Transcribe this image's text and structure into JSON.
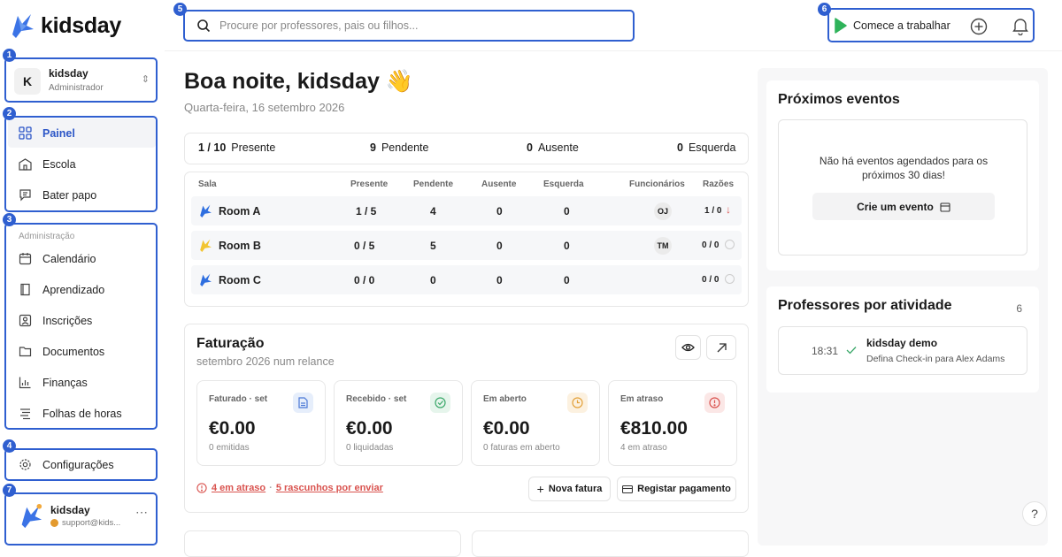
{
  "app": {
    "name": "kidsday"
  },
  "badges": [
    "1",
    "2",
    "3",
    "4",
    "5",
    "6",
    "7"
  ],
  "account": {
    "initial": "K",
    "name": "kidsday",
    "role": "Administrador"
  },
  "nav": {
    "main": [
      {
        "label": "Painel",
        "icon": "grid-icon",
        "active": true
      },
      {
        "label": "Escola",
        "icon": "school-icon"
      },
      {
        "label": "Bater papo",
        "icon": "chat-icon"
      }
    ],
    "admin_title": "Administração",
    "admin": [
      {
        "label": "Calendário",
        "icon": "calendar-icon"
      },
      {
        "label": "Aprendizado",
        "icon": "book-icon"
      },
      {
        "label": "Inscrições",
        "icon": "enroll-icon"
      },
      {
        "label": "Documentos",
        "icon": "folder-icon"
      },
      {
        "label": "Finanças",
        "icon": "finance-icon"
      },
      {
        "label": "Folhas de horas",
        "icon": "timesheet-icon"
      }
    ],
    "settings": "Configurações"
  },
  "user": {
    "name": "kidsday",
    "email": "support@kids..."
  },
  "search": {
    "placeholder": "Procure por professores, pais ou filhos..."
  },
  "top": {
    "work_label": "Comece a trabalhar"
  },
  "greeting": {
    "title": "Boa noite, kidsday 👋",
    "date": "Quarta-feira, 16 setembro 2026"
  },
  "stats": [
    {
      "value": "1 / 10",
      "label": "Presente"
    },
    {
      "value": "9",
      "label": "Pendente"
    },
    {
      "value": "0",
      "label": "Ausente"
    },
    {
      "value": "0",
      "label": "Esquerda"
    }
  ],
  "table": {
    "headers": [
      "Sala",
      "Presente",
      "Pendente",
      "Ausente",
      "Esquerda",
      "Funcionários",
      "Razões"
    ],
    "rows": [
      {
        "name": "Room A",
        "present": "1 / 5",
        "pending": "4",
        "absent": "0",
        "left": "0",
        "staff": "OJ",
        "ratio": "1 / 0",
        "color": "#2f6fe0"
      },
      {
        "name": "Room B",
        "present": "0 / 5",
        "pending": "5",
        "absent": "0",
        "left": "0",
        "staff": "TM",
        "ratio": "0 / 0",
        "color": "#f2c531"
      },
      {
        "name": "Room C",
        "present": "0 / 0",
        "pending": "0",
        "absent": "0",
        "left": "0",
        "staff": "",
        "ratio": "0 / 0",
        "color": "#2f6fe0"
      }
    ]
  },
  "billing": {
    "title": "Faturação",
    "subtitle": "setembro 2026 num relance",
    "cards": [
      {
        "label": "Faturado · set",
        "value": "€0.00",
        "sub": "0 emitidas",
        "color": "#4a78d6",
        "bg": "#e6eefb"
      },
      {
        "label": "Recebido · set",
        "value": "€0.00",
        "sub": "0 liquidadas",
        "color": "#3ba86a",
        "bg": "#e6f5ec"
      },
      {
        "label": "Em aberto",
        "value": "€0.00",
        "sub": "0 faturas em aberto",
        "color": "#e3a13a",
        "bg": "#fcf1e0"
      },
      {
        "label": "Em atraso",
        "value": "€810.00",
        "sub": "4 em atraso",
        "color": "#d9534f",
        "bg": "#fbe7e6"
      }
    ],
    "overdue_link": "4 em atraso",
    "sep": "·",
    "drafts_link": "5 rascunhos por enviar",
    "new_invoice": "Nova fatura",
    "register_payment": "Registar pagamento"
  },
  "events": {
    "title": "Próximos eventos",
    "empty": "Não há eventos agendados para os próximos 30 dias!",
    "create": "Crie um evento"
  },
  "teachers": {
    "title": "Professores por atividade",
    "count": "6",
    "item": {
      "time": "18:31",
      "name": "kidsday demo",
      "desc": "Defina Check-in para Alex Adams"
    }
  },
  "help": "?"
}
